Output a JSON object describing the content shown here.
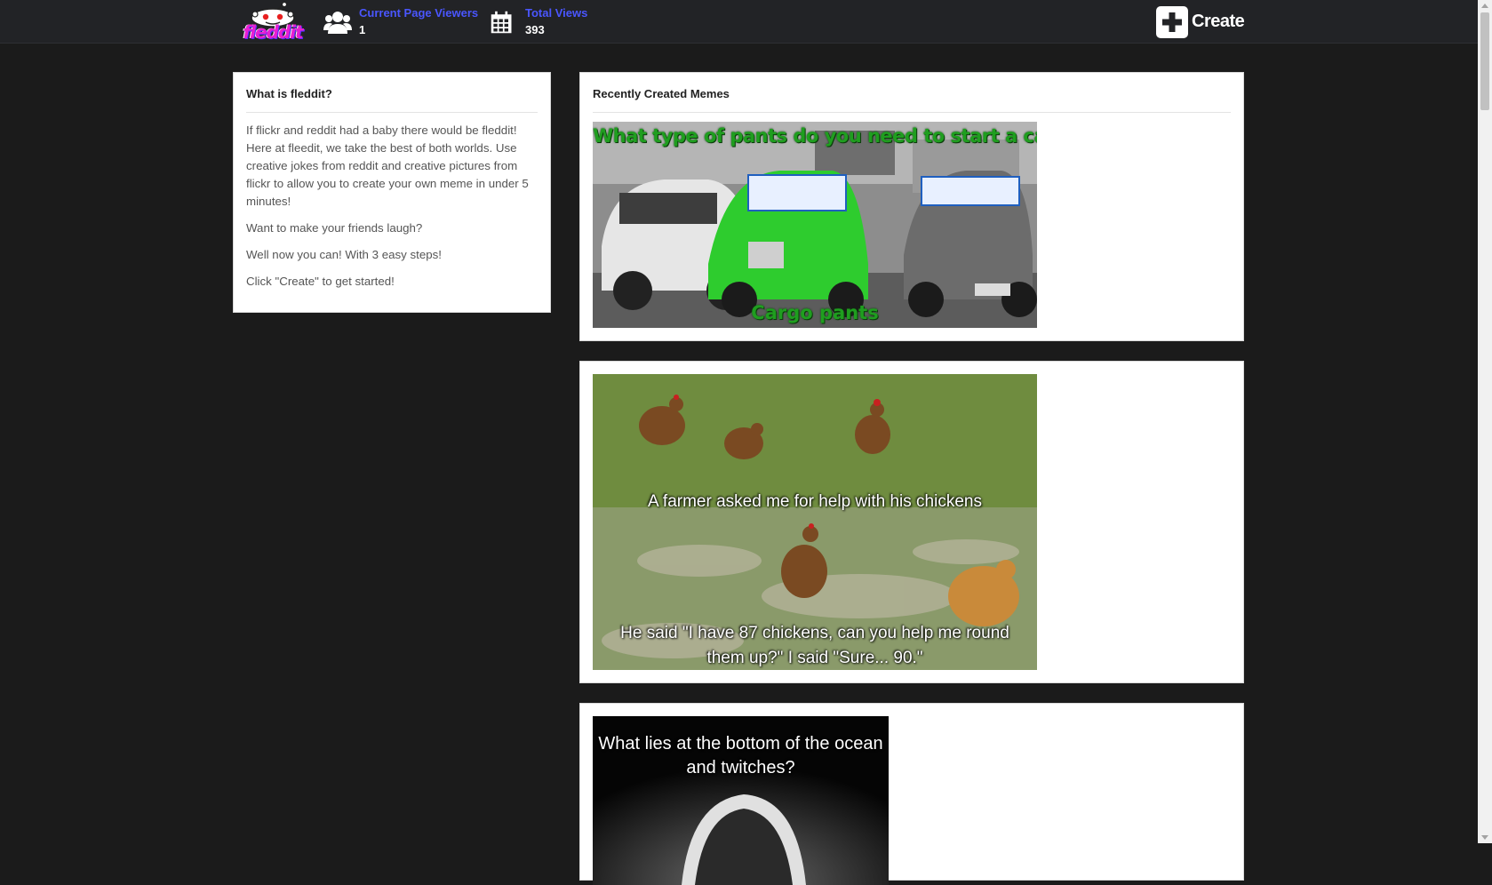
{
  "brand": {
    "logo_text": "fleddit"
  },
  "stats": {
    "viewers": {
      "label": "Current Page Viewers",
      "value": "1",
      "icon": "users-icon"
    },
    "views": {
      "label": "Total Views",
      "value": "393",
      "icon": "calendar-icon"
    }
  },
  "create": {
    "label": "Create",
    "icon": "plus-square-icon"
  },
  "about": {
    "title": "What is fleddit?",
    "paragraphs": [
      "If flickr and reddit had a baby there would be fleddit! Here at fleedit, we take the best of both worlds. Use creative jokes from reddit and creative pictures from flickr to allow you to create your own meme in under 5 minutes!",
      "Want to make your friends laugh?",
      "Well now you can! With 3 easy steps!",
      "Click \"Create\" to get started!"
    ]
  },
  "memes": {
    "title": "Recently Created Memes",
    "items": [
      {
        "top": "What type of pants do you need to start a car?",
        "bottom": "Cargo pants",
        "scene": "vintage cars with city tours signs"
      },
      {
        "top": "A farmer asked me for help with his chickens",
        "bottom": "He said \"I have 87 chickens, can you help me round them up?\" I said \"Sure... 90.\"",
        "scene": "chickens on grass"
      },
      {
        "top": "What lies at the bottom of the ocean and twitches?",
        "bottom": "",
        "scene": "black and white portrait"
      }
    ]
  },
  "colors": {
    "background": "#1b1b1b",
    "topbar": "#222326",
    "link": "#4a56ff",
    "panel": "#ffffff"
  }
}
